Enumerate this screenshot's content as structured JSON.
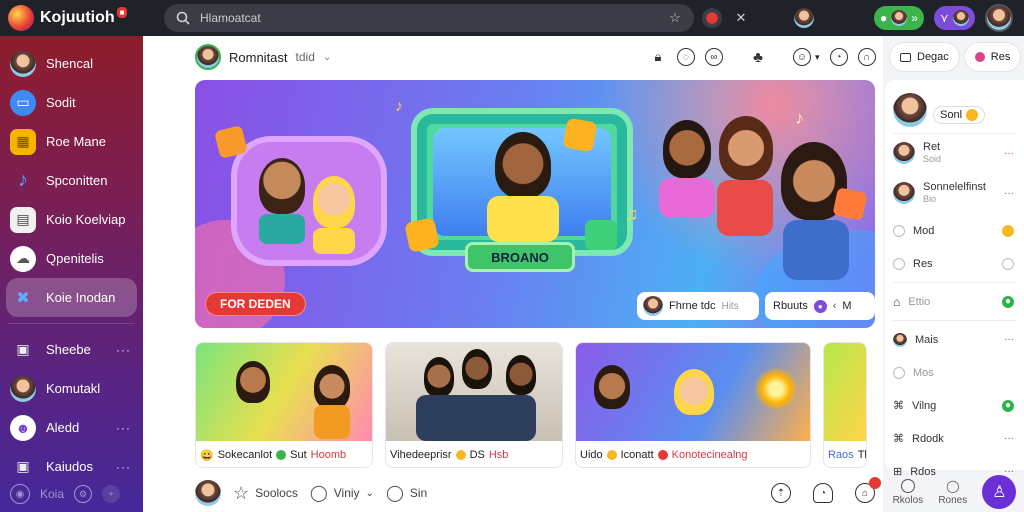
{
  "app": {
    "name": "Kojuutioh",
    "badge": "■"
  },
  "search": {
    "placeholder": "Hlamoatcat"
  },
  "sidebar": {
    "items": [
      {
        "label": "Shencal",
        "icon": "profile-avatar"
      },
      {
        "label": "Sodit",
        "icon": "chat-icon"
      },
      {
        "label": "Roe Mane",
        "icon": "grid-icon"
      },
      {
        "label": "Spconitten",
        "icon": "music-note-icon"
      },
      {
        "label": "Koio Koelviap",
        "icon": "video-icon"
      },
      {
        "label": "Qpenitelis",
        "icon": "cloud-icon"
      },
      {
        "label": "Koie Inodan",
        "icon": "puzzle-icon"
      },
      {
        "label": "Sheebe",
        "icon": "bag-icon"
      },
      {
        "label": "Komutakl",
        "icon": "profile-avatar"
      },
      {
        "label": "Aledd",
        "icon": "people-icon"
      },
      {
        "label": "Kaiudos",
        "icon": "bag-icon"
      }
    ],
    "bottom_label": "Koia"
  },
  "main": {
    "header": {
      "title": "Romnitast",
      "subtitle": "tdid"
    },
    "hero": {
      "cta_label": "FOR DEDEN",
      "banner_label": "BROANO",
      "chip_a_label": "Fhrne tdc",
      "chip_a_tag": "Hits",
      "chip_b_label": "Rbuuts",
      "chip_b_tag": "M"
    },
    "cards": [
      {
        "caption_a": "Sokecanlot",
        "caption_b": "Sut",
        "caption_c": "Hoomb"
      },
      {
        "caption_a": "Vihedeeprisr",
        "caption_b": "DS",
        "caption_c": "Hsb"
      },
      {
        "caption_a": "Uido",
        "caption_b": "Iconatt",
        "caption_c": "Konotecinealng"
      },
      {
        "caption_a": "Raos",
        "caption_b": "Thu",
        "caption_c": ""
      }
    ],
    "footer": {
      "item1": "Soolocs",
      "item2": "Viniy",
      "item3": "Sin"
    }
  },
  "right_panel": {
    "btn1": "Degac",
    "btn2": "Res",
    "profile_label": "Sonl",
    "rows": [
      {
        "title": "Ret",
        "sub": "Soid"
      },
      {
        "title": "Sonnelelfinst",
        "sub": "Bio"
      },
      {
        "label": "Mod"
      },
      {
        "label": "Res"
      },
      {
        "label": "Ettio"
      },
      {
        "label": "Mais"
      },
      {
        "label": "Mos"
      },
      {
        "label": "Vilng"
      },
      {
        "label": "Rdodk"
      },
      {
        "label": "Rdos"
      }
    ],
    "footer": {
      "left": "Rkolos",
      "mid": "Rones"
    }
  }
}
